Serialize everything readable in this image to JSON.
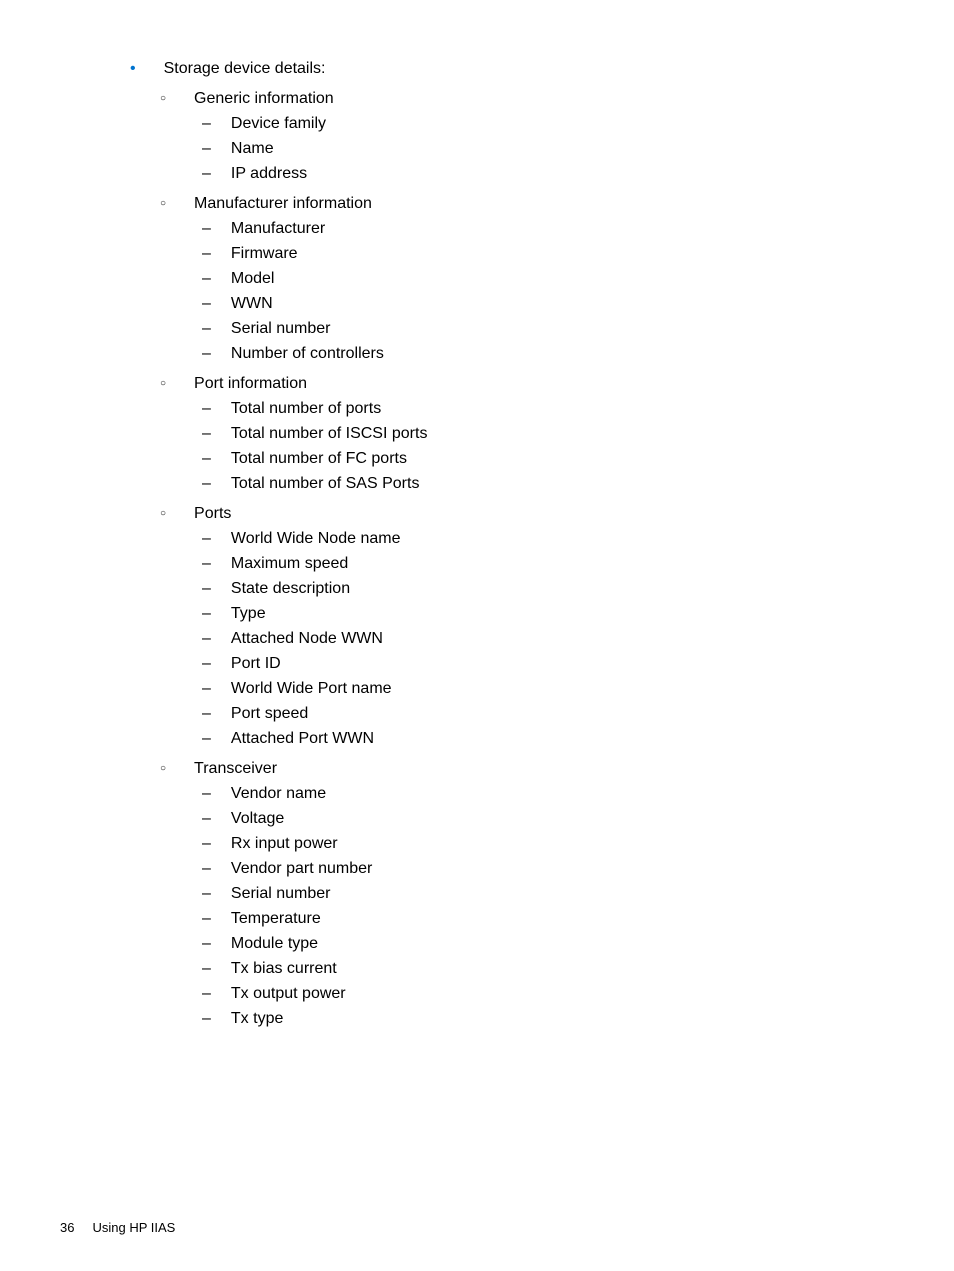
{
  "level1": {
    "text": "Storage device details:"
  },
  "sections": [
    {
      "heading": "Generic information",
      "items": [
        "Device family",
        "Name",
        "IP address"
      ]
    },
    {
      "heading": "Manufacturer information",
      "items": [
        "Manufacturer",
        "Firmware",
        "Model",
        "WWN",
        "Serial number",
        "Number of controllers"
      ]
    },
    {
      "heading": "Port information",
      "items": [
        "Total number of ports",
        "Total number of ISCSI ports",
        "Total number of FC ports",
        "Total number of SAS Ports"
      ]
    },
    {
      "heading": "Ports",
      "items": [
        "World Wide Node name",
        "Maximum speed",
        "State description",
        "Type",
        "Attached Node WWN",
        "Port ID",
        "World Wide Port name",
        "Port speed",
        "Attached Port WWN"
      ]
    },
    {
      "heading": "Transceiver",
      "items": [
        "Vendor name",
        "Voltage",
        "Rx input power",
        "Vendor part number",
        "Serial number",
        "Temperature",
        "Module type",
        "Tx bias current",
        "Tx output power",
        "Tx type"
      ]
    }
  ],
  "footer": {
    "pageNumber": "36",
    "sectionTitle": "Using HP IIAS"
  }
}
